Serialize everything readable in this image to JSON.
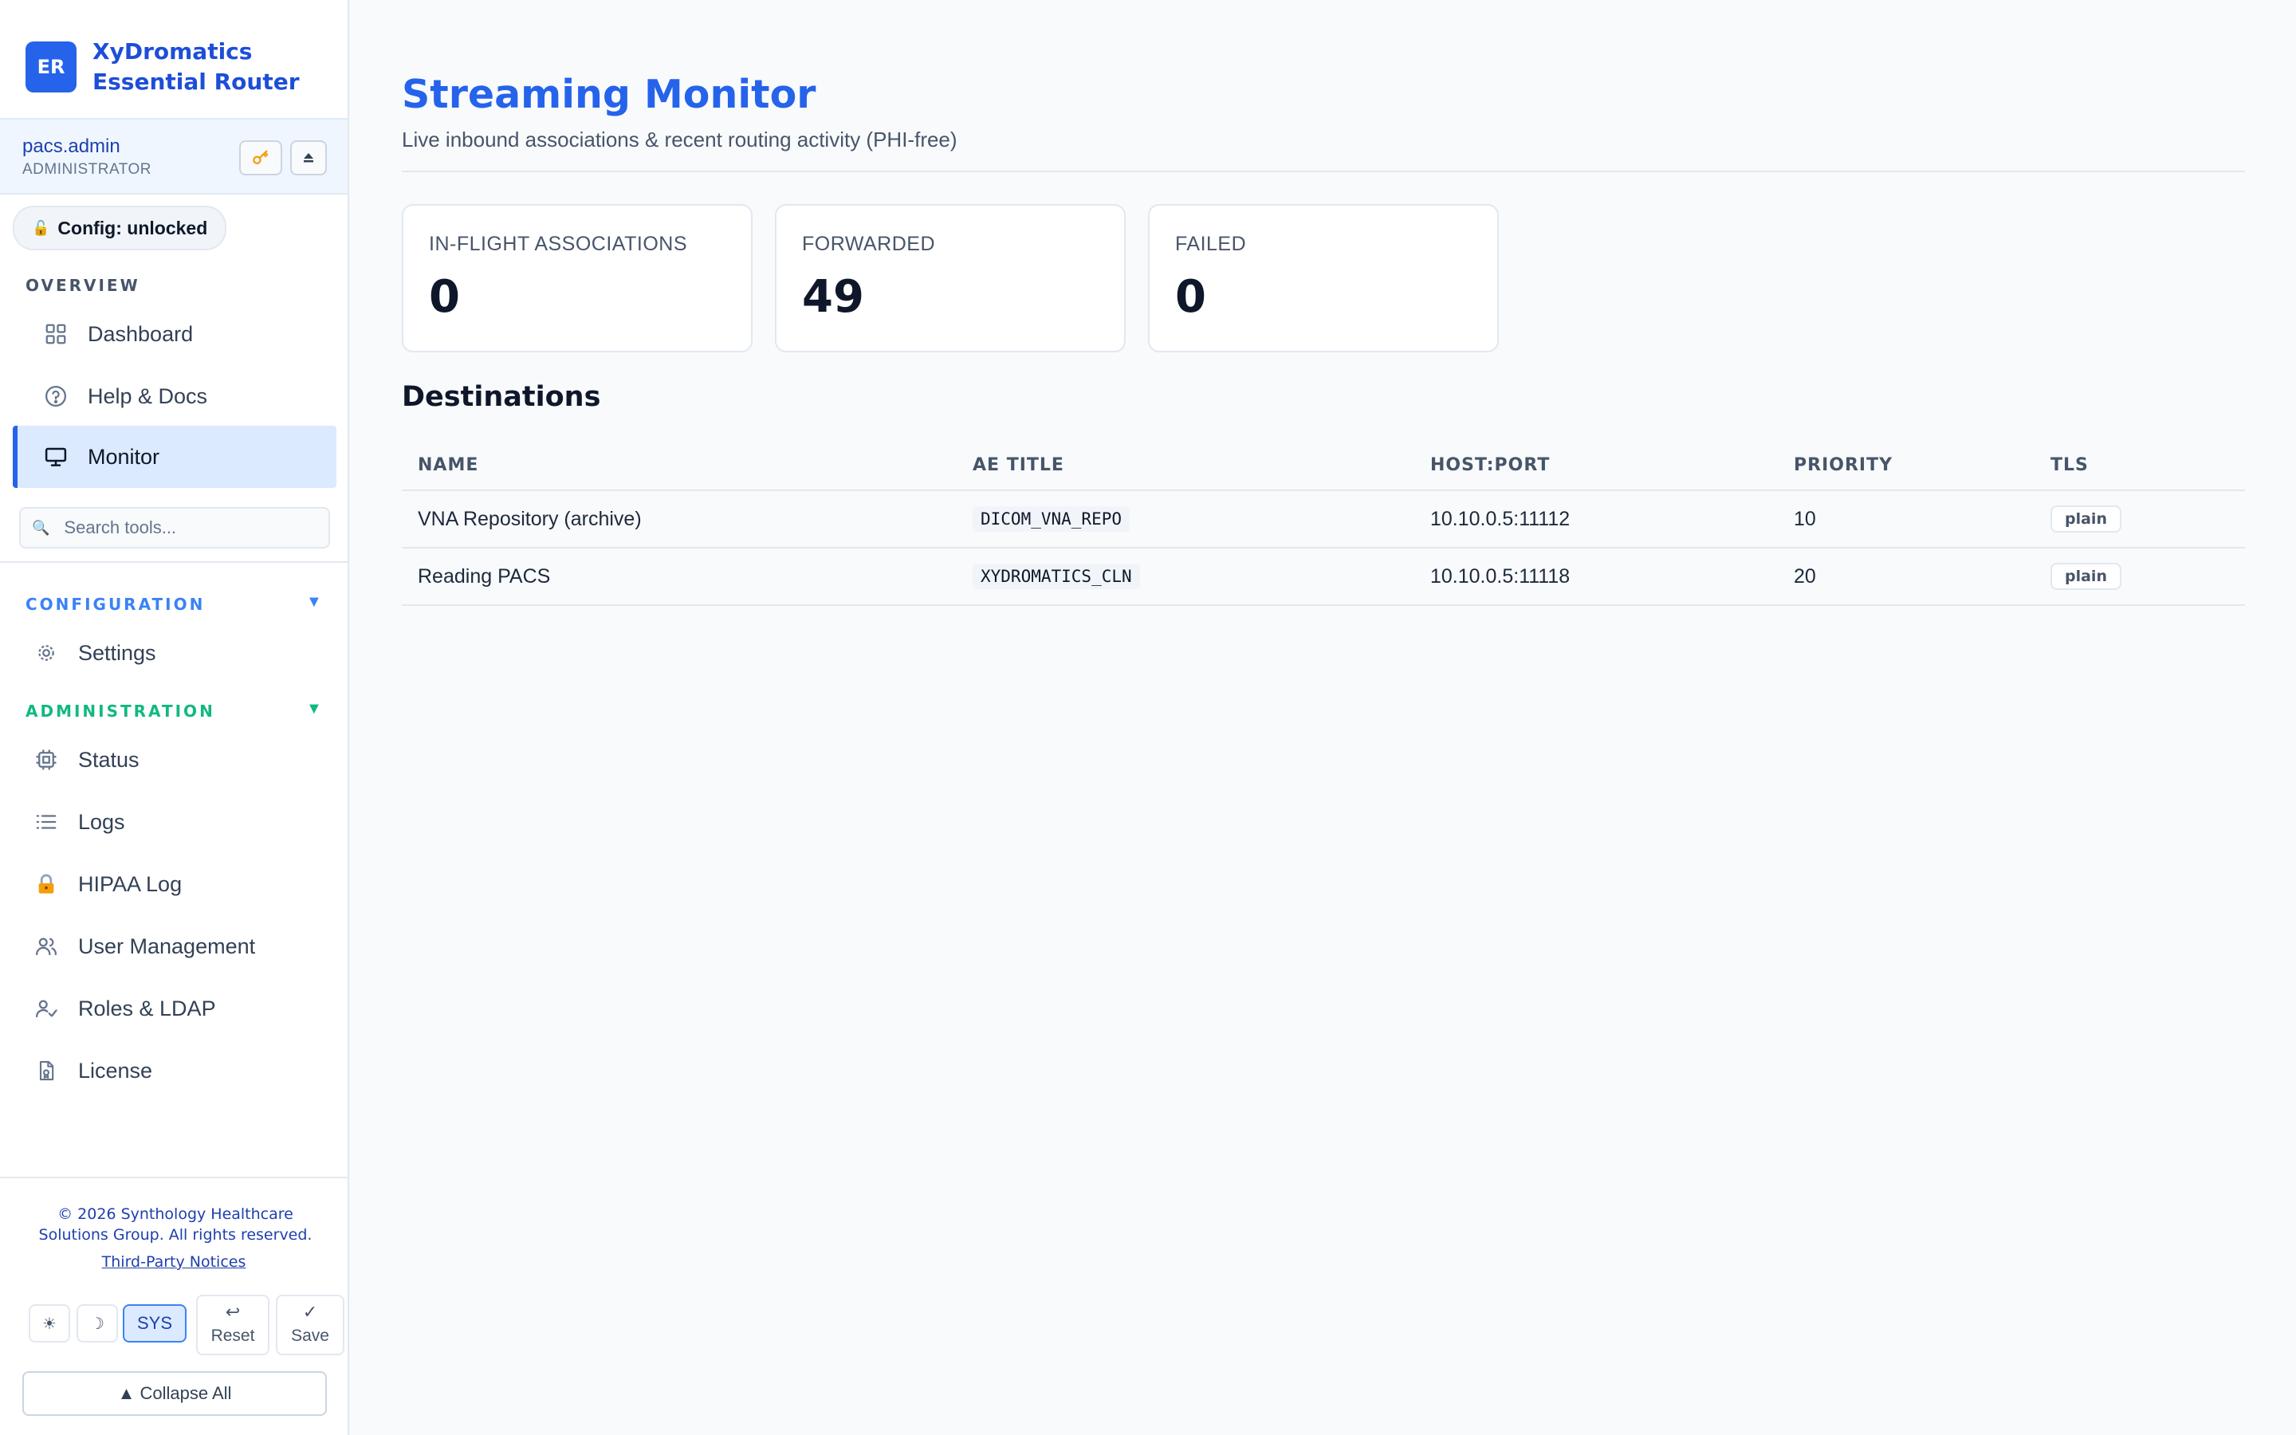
{
  "brand": {
    "logo": "ER",
    "name_line1": "XyDromatics",
    "name_line2": "Essential Router"
  },
  "user": {
    "name": "pacs.admin",
    "role": "ADMINISTRATOR",
    "key_icon": "key-icon",
    "eject_icon": "eject-icon"
  },
  "config_status": "Config: unlocked",
  "sidebar": {
    "overview_label": "OVERVIEW",
    "overview_items": [
      {
        "label": "Dashboard",
        "icon": "grid-icon"
      },
      {
        "label": "Help & Docs",
        "icon": "help-circle-icon"
      },
      {
        "label": "Monitor",
        "icon": "monitor-icon",
        "active": true
      }
    ],
    "search_placeholder": "Search tools...",
    "configuration_label": "CONFIGURATION",
    "configuration_items": [
      {
        "label": "Settings",
        "icon": "gear-icon"
      }
    ],
    "administration_label": "ADMINISTRATION",
    "administration_items": [
      {
        "label": "Status",
        "icon": "cpu-icon"
      },
      {
        "label": "Logs",
        "icon": "list-icon"
      },
      {
        "label": "HIPAA Log",
        "icon": "lock-icon"
      },
      {
        "label": "User Management",
        "icon": "users-icon"
      },
      {
        "label": "Roles & LDAP",
        "icon": "user-check-icon"
      },
      {
        "label": "License",
        "icon": "file-icon"
      }
    ],
    "section_colors": {
      "configuration": "#3b82f6",
      "administration": "#10b981"
    }
  },
  "footer": {
    "copyright": "© 2026 Synthology Healthcare Solutions Group. All rights reserved.",
    "notices_link": "Third-Party Notices",
    "theme_light": "☀",
    "theme_dark": "☽",
    "theme_sys": "SYS",
    "reset_glyph": "↩",
    "reset_label": "Reset",
    "save_glyph": "✓",
    "save_label": "Save",
    "collapse_label": "▲ Collapse All"
  },
  "main": {
    "title": "Streaming Monitor",
    "subtitle": "Live inbound associations & recent routing activity (PHI-free)",
    "stats": [
      {
        "label": "IN-FLIGHT ASSOCIATIONS",
        "value": "0"
      },
      {
        "label": "FORWARDED",
        "value": "49"
      },
      {
        "label": "FAILED",
        "value": "0"
      }
    ],
    "destinations_heading": "Destinations",
    "table": {
      "columns": [
        "NAME",
        "AE TITLE",
        "HOST:PORT",
        "PRIORITY",
        "TLS"
      ],
      "rows": [
        {
          "name": "VNA Repository (archive)",
          "ae_title": "DICOM_VNA_REPO",
          "host_port": "10.10.0.5:11112",
          "priority": "10",
          "tls": "plain"
        },
        {
          "name": "Reading PACS",
          "ae_title": "XYDROMATICS_CLN",
          "host_port": "10.10.0.5:11118",
          "priority": "20",
          "tls": "plain"
        }
      ]
    }
  },
  "colors": {
    "accent": "#2563eb",
    "active_bg": "#dbeafe"
  }
}
